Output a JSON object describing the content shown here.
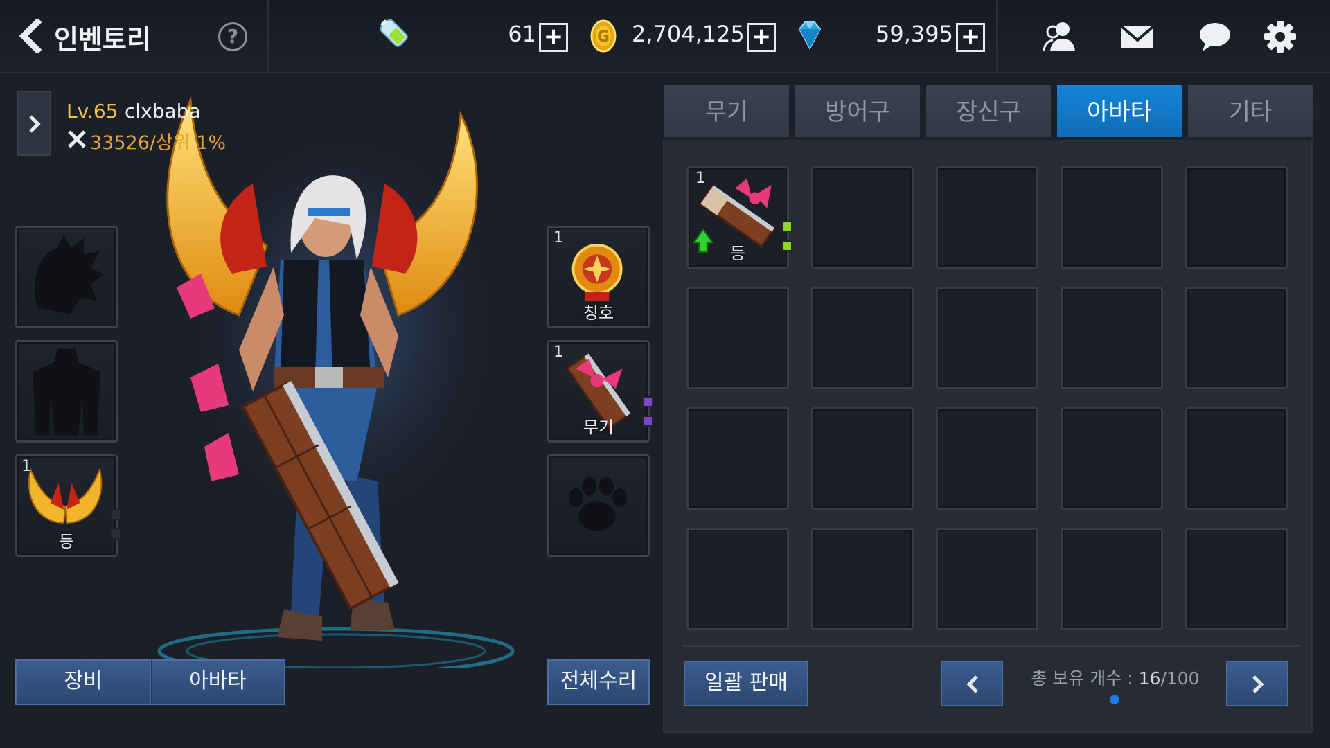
{
  "header": {
    "title": "인벤토리",
    "help_label": "?",
    "currencies": {
      "stamina_value": "61",
      "gold_value": "2,704,125",
      "gem_value": "59,395",
      "plus_label": "+"
    },
    "icons": [
      "back-icon",
      "battery-icon",
      "gold-coin-icon",
      "diamond-icon",
      "friends-icon",
      "mail-icon",
      "chat-icon",
      "gear-icon"
    ]
  },
  "character": {
    "level": "Lv.65",
    "name": "clxbaba",
    "power_text": "33526/상위 1%"
  },
  "equip_slots": {
    "back_slot": {
      "count": "1",
      "label": "등"
    },
    "title_slot": {
      "count": "1",
      "label": "칭호"
    },
    "weapon_slot": {
      "count": "1",
      "label": "무기"
    }
  },
  "left_buttons": {
    "equipment": "장비",
    "avatar": "아바타",
    "repair_all": "전체수리"
  },
  "tabs": [
    {
      "label": "무기",
      "active": false
    },
    {
      "label": "방어구",
      "active": false
    },
    {
      "label": "장신구",
      "active": false
    },
    {
      "label": "아바타",
      "active": true
    },
    {
      "label": "기타",
      "active": false
    }
  ],
  "inventory": {
    "first_item": {
      "count": "1",
      "label": "등"
    },
    "bulk_sell_label": "일괄 판매",
    "count_label": "총 보유 개수 : ",
    "count_current": "16",
    "count_total": "/100"
  },
  "colors": {
    "active_tab": "#1583d6",
    "button_blue": "#2f4a78",
    "level_gold": "#f6c34a",
    "power_orange": "#e9a637",
    "gem_green": "#8bd91e",
    "gem_purple": "#7b44d8"
  }
}
